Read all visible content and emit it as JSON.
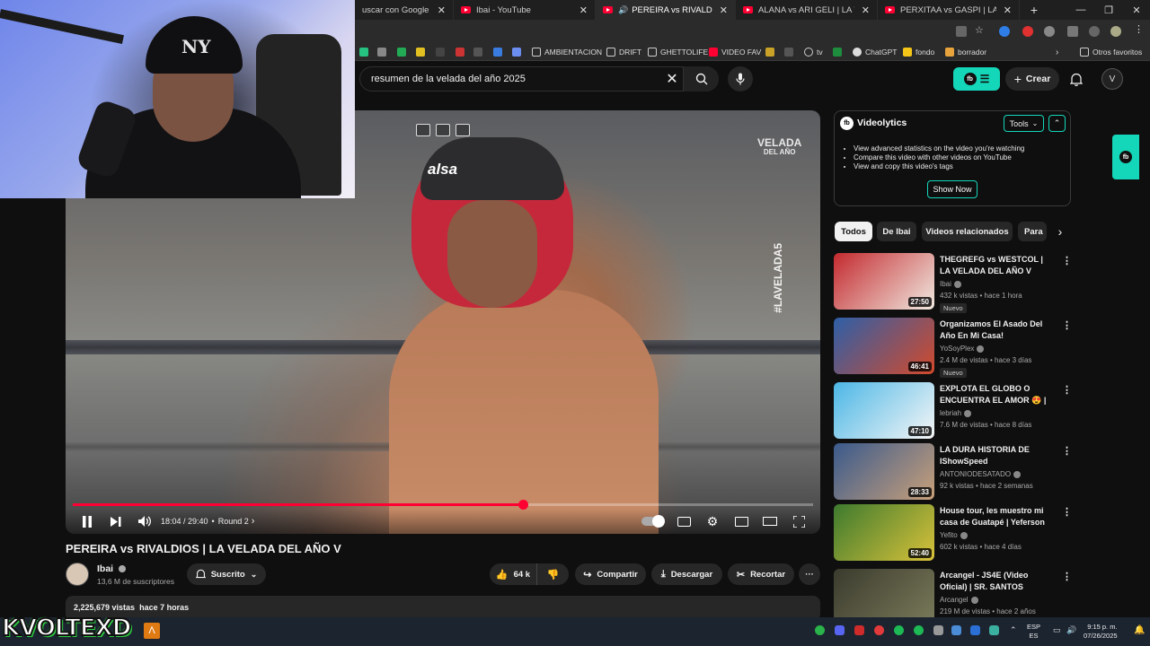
{
  "browser": {
    "tabs": [
      {
        "label": "uscar con Google",
        "active": false
      },
      {
        "label": "Ibai - YouTube",
        "active": false
      },
      {
        "label": "PEREIRA vs RIVALDIOS | LA",
        "active": true
      },
      {
        "label": "ALANA vs ARI GELI | LA VELADA",
        "active": false
      },
      {
        "label": "PERXITAA vs GASPI | LA VELADA",
        "active": false
      }
    ],
    "new_tab": "+",
    "window_controls": [
      "—",
      "❐",
      "✕"
    ],
    "bookmarks": [
      {
        "label": "AMBIENTACION"
      },
      {
        "label": "DRIFT"
      },
      {
        "label": "GHETTOLIFE"
      },
      {
        "label": "VIDEO FAV"
      },
      {
        "label": "tv"
      },
      {
        "label": "ChatGPT"
      },
      {
        "label": "fondo"
      },
      {
        "label": "borrador"
      },
      {
        "label": "Otros favoritos"
      }
    ]
  },
  "header": {
    "search_query": "resumen de la velada del año 2025",
    "clear_icon": "✕",
    "create_label": "Crear",
    "avatar_letter": "V"
  },
  "player": {
    "time_label": "18:04 / 29:40",
    "chapter": "Round 2",
    "progress": 0.6085,
    "watermark_brand": "VELADA",
    "watermark_sub": "DEL AÑO",
    "watermark_tag": "#LAVELADA5",
    "helmet_brand": "alsa"
  },
  "webcam": {
    "cap_logo": "NY"
  },
  "video": {
    "title": "PEREIRA vs RIVALDIOS | LA VELADA DEL AÑO V",
    "channel": "Ibai",
    "subscribers": "13,6 M de suscriptores",
    "subscribe_label": "Suscrito",
    "likes": "64 k",
    "share_label": "Compartir",
    "download_label": "Descargar",
    "clip_label": "Recortar",
    "more_label": "···",
    "views": "2,225,679 vistas",
    "published": "hace 7 horas"
  },
  "videolytics": {
    "logo": "fb",
    "title": "Videolytics",
    "tools_label": "Tools",
    "bullets": [
      "View advanced statistics on the video you're watching",
      "Compare this video with other videos on YouTube",
      "View and copy this video's tags"
    ],
    "show_label": "Show Now"
  },
  "chips": [
    {
      "label": "Todos",
      "active": true
    },
    {
      "label": "De Ibai",
      "active": false
    },
    {
      "label": "Videos relacionados",
      "active": false
    },
    {
      "label": "Para",
      "active": false
    }
  ],
  "recommendations": [
    {
      "title": "THEGREFG vs WESTCOL | LA VELADA DEL AÑO V",
      "channel": "Ibai",
      "meta": "432 k vistas • hace 1 hora",
      "badge": "Nuevo",
      "duration": "27:50",
      "thumb": [
        "#c42a2f",
        "#f0e9e0"
      ]
    },
    {
      "title": "Organizamos El Asado Del Año En Mi Casa!",
      "channel": "YoSoyPlex",
      "meta": "2.4 M de vistas • hace 3 días",
      "badge": "Nuevo",
      "duration": "46:41",
      "thumb": [
        "#2d5fa8",
        "#d34a2c"
      ]
    },
    {
      "title": "EXPLOTA EL GLOBO O ENCUENTRA EL AMOR 😍 | ...",
      "channel": "lebriah",
      "meta": "7.6 M de vistas • hace 8 días",
      "badge": "",
      "duration": "47:10",
      "thumb": [
        "#4cb7e6",
        "#f6f6f6"
      ]
    },
    {
      "title": "LA DURA HISTORIA DE IShowSpeed",
      "channel": "ANTONIODESATADO",
      "meta": "92 k vistas • hace 2 semanas",
      "badge": "",
      "duration": "28:33",
      "thumb": [
        "#3a5a8c",
        "#c8a07a"
      ]
    },
    {
      "title": "House tour, les muestro mi casa de Guatapé | Yeferson Cossio",
      "channel": "Yefito",
      "meta": "602 k vistas • hace 4 días",
      "badge": "",
      "duration": "52:40",
      "thumb": [
        "#3d7a2e",
        "#d9c23a"
      ]
    },
    {
      "title": "Arcangel - JS4E (Video Oficial) | SR. SANTOS",
      "channel": "Arcangel",
      "meta": "219 M de vistas • hace 2 años",
      "badge": "",
      "duration": "",
      "thumb": [
        "#3b3b2e",
        "#7a7a5a"
      ]
    }
  ],
  "taskbar": {
    "overlay_logo": "KVOLTEXD",
    "lang_top": "ESP",
    "lang_bottom": "ES",
    "time": "9:15 p. m.",
    "date": "07/26/2025"
  },
  "colors": {
    "yt_red": "#ff0033",
    "videolytics_accent": "#14d6b8",
    "background": "#0f0f0f"
  }
}
